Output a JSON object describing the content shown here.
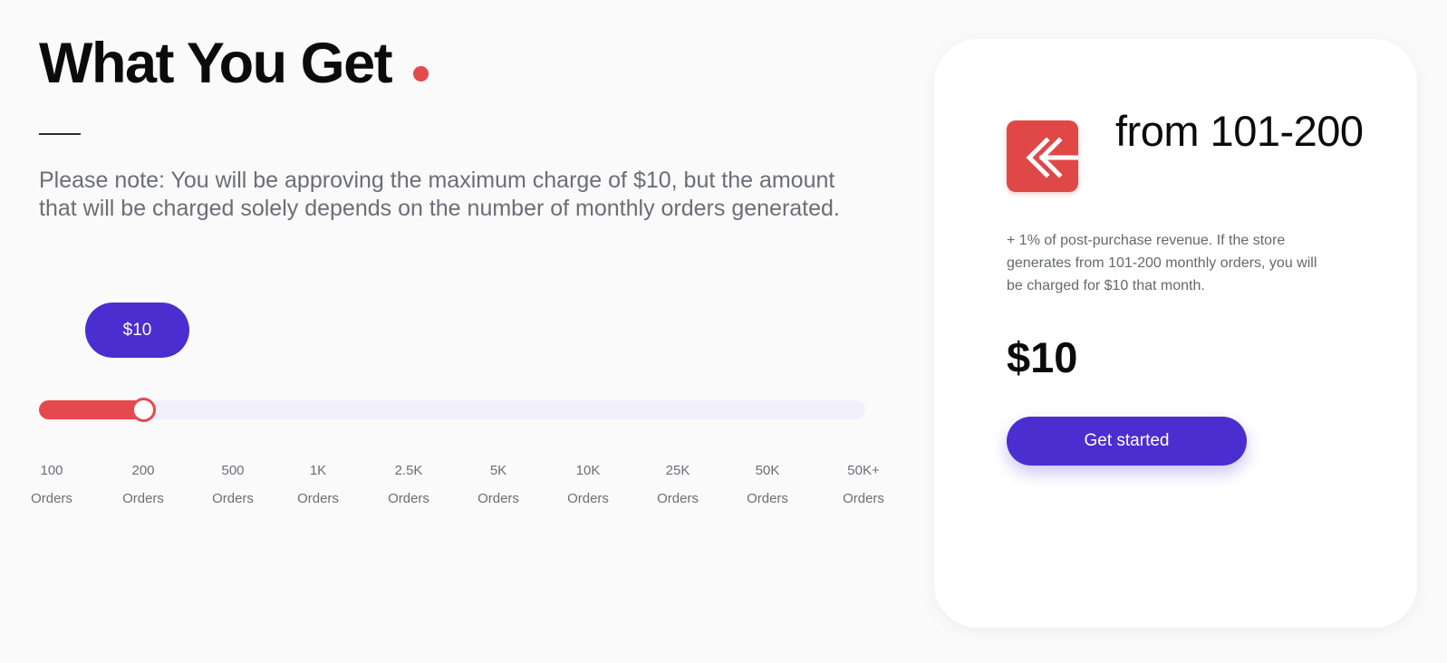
{
  "header": {
    "title": "What You Get",
    "note": "Please note: You will be approving the maximum charge of $10, but the amount that will be charged solely depends on the number of monthly orders generated."
  },
  "slider": {
    "bubble_label": "$10",
    "selected_index": 1,
    "ticks": [
      {
        "value": "100",
        "unit": "Orders"
      },
      {
        "value": "200",
        "unit": "Orders"
      },
      {
        "value": "500",
        "unit": "Orders"
      },
      {
        "value": "1K",
        "unit": "Orders"
      },
      {
        "value": "2.5K",
        "unit": "Orders"
      },
      {
        "value": "5K",
        "unit": "Orders"
      },
      {
        "value": "10K",
        "unit": "Orders"
      },
      {
        "value": "25K",
        "unit": "Orders"
      },
      {
        "value": "50K",
        "unit": "Orders"
      },
      {
        "value": "50K+",
        "unit": "Orders"
      }
    ]
  },
  "plan_card": {
    "logo_icon": "double-chevron-left-icon",
    "range": "from 101-200",
    "description": "+ 1% of post-purchase revenue. If the store generates from 101-200 monthly orders, you will be charged for $10 that month.",
    "price": "$10",
    "cta_label": "Get started"
  },
  "colors": {
    "accent_red": "#e5484d",
    "primary_purple": "#4a2ed0",
    "track": "#f1effb",
    "muted_text": "#6b6e76"
  }
}
